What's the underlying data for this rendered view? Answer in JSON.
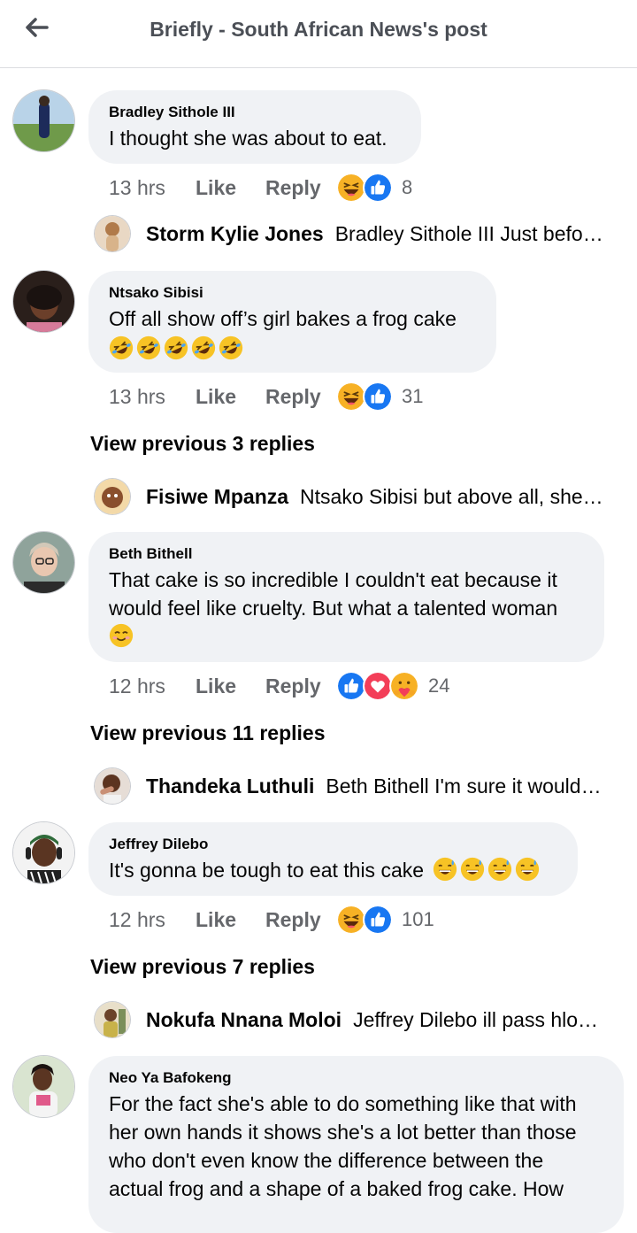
{
  "header": {
    "title": "Briefly - South African News's post",
    "back_icon": "arrow-left-icon"
  },
  "actions": {
    "like_label": "Like",
    "reply_label": "Reply"
  },
  "comments": [
    {
      "author": "Bradley Sithole III",
      "text": "I thought she was about to eat.",
      "time": "13 hrs",
      "reaction_count": "8",
      "reactions": [
        "haha",
        "like"
      ],
      "reply_preview": {
        "name": "Storm Kylie Jones",
        "text": "Bradley Sithole III Just before…"
      }
    },
    {
      "author": "Ntsako Sibisi",
      "text": "Off all show off’s girl bakes a frog cake",
      "emoji_line": "rofl x5",
      "time": "13 hrs",
      "reaction_count": "31",
      "reactions": [
        "haha",
        "like"
      ],
      "view_previous": "View previous 3 replies",
      "reply_preview": {
        "name": "Fisiwe Mpanza",
        "text": "Ntsako Sibisi but above all, she…"
      }
    },
    {
      "author": "Beth Bithell",
      "text_line1": "That cake is so incredible I couldn't eat because it",
      "text_line2": "would feel like cruelty. But what a talented woman",
      "emoji_line": "smiling-face",
      "time": "12 hrs",
      "reaction_count": "24",
      "reactions": [
        "like",
        "love",
        "care"
      ],
      "view_previous": "View previous 11 replies",
      "reply_preview": {
        "name": "Thandeka Luthuli",
        "text": "Beth Bithell I'm sure it would…"
      }
    },
    {
      "author": "Jeffrey Dilebo",
      "text": "It's gonna be tough to eat this cake",
      "time": "12 hrs",
      "reaction_count": "101",
      "reactions": [
        "haha",
        "like"
      ],
      "view_previous": "View previous 7 replies",
      "reply_preview": {
        "name": "Nokufa Nnana Moloi",
        "text": "Jeffrey Dilebo ill pass hlo…"
      }
    },
    {
      "author": "Neo Ya Bafokeng",
      "lines": [
        "For the fact she's able to do something like that with",
        "her own hands it shows she's a lot better than those",
        "who don't even  know the difference between the",
        "actual frog and a shape of a baked frog cake. How"
      ]
    }
  ],
  "colors": {
    "bubble": "#f0f2f5",
    "meta": "#65676b",
    "like_blue": "#1877f2",
    "love_red": "#f33e58",
    "haha_yellow": "#f7b125"
  }
}
